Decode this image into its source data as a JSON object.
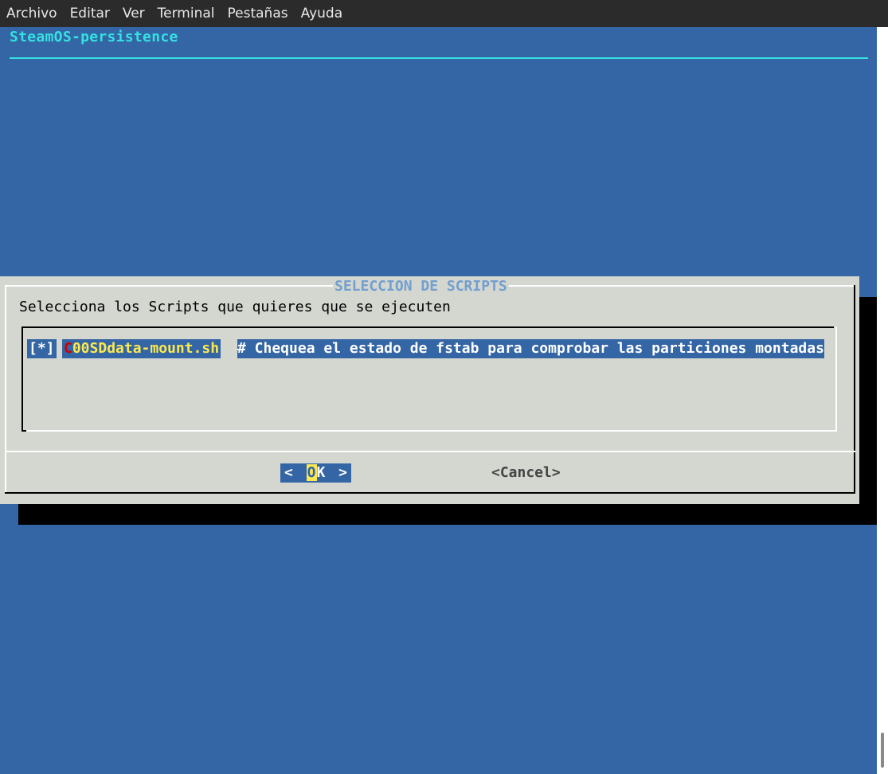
{
  "menubar": {
    "items": [
      "Archivo",
      "Editar",
      "Ver",
      "Terminal",
      "Pestañas",
      "Ayuda"
    ]
  },
  "backtitle": "SteamOS-persistence",
  "dialog": {
    "title": "SELECCION DE SCRIPTS",
    "prompt": "Selecciona los Scripts que quieres que se ejecuten",
    "items": [
      {
        "check": "[*]",
        "tag_hotkey": "C",
        "tag_rest": "00SDdata-mount.sh",
        "description": "# Chequea el estado de fstab para comprobar las particiones montadas"
      }
    ],
    "buttons": {
      "ok_left": "<",
      "ok_hot": "O",
      "ok_rest": "K",
      "ok_right": ">",
      "cancel": "<Cancel>"
    }
  },
  "colors": {
    "background": "#3465a4",
    "dialog": "#d3d7cf",
    "accent": "#34e2e2",
    "highlight": "#fce94f",
    "title": "#729fcf"
  }
}
